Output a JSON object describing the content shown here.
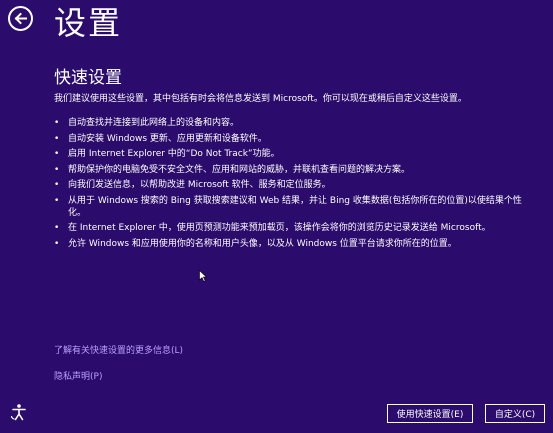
{
  "header": {
    "title": "设置",
    "back_icon": "back-arrow-icon"
  },
  "main": {
    "section_title": "快速设置",
    "intro": "我们建议使用这些设置，其中包括有时会将信息发送到 Microsoft。你可以现在或稍后自定义这些设置。",
    "bullets": [
      "自动查找并连接到此网络上的设备和内容。",
      "自动安装 Windows 更新、应用更新和设备软件。",
      "启用 Internet Explorer 中的“Do Not Track”功能。",
      "帮助保护你的电脑免受不安全文件、应用和网站的威胁，并联机查看问题的解决方案。",
      "向我们发送信息，以帮助改进 Microsoft 软件、服务和定位服务。",
      "从用于 Windows 搜索的 Bing 获取搜索建议和 Web 结果，并让 Bing 收集数据(包括你所在的位置)以使结果个性化。",
      "在 Internet Explorer 中，使用页预测功能来预加载页，该操作会将你的浏览历史记录发送给 Microsoft。",
      "允许 Windows 和应用使用你的名称和用户头像，以及从 Windows 位置平台请求你所在的位置。"
    ]
  },
  "links": {
    "more_info": "了解有关快速设置的更多信息(L)",
    "privacy": "隐私声明(P)"
  },
  "footer": {
    "express_button": "使用快速设置(E)",
    "custom_button": "自定义(C)",
    "accessibility_icon": "ease-of-access-icon"
  },
  "colors": {
    "background": "#2b0b6b",
    "text": "#ffffff",
    "link": "#b9a0ff"
  }
}
